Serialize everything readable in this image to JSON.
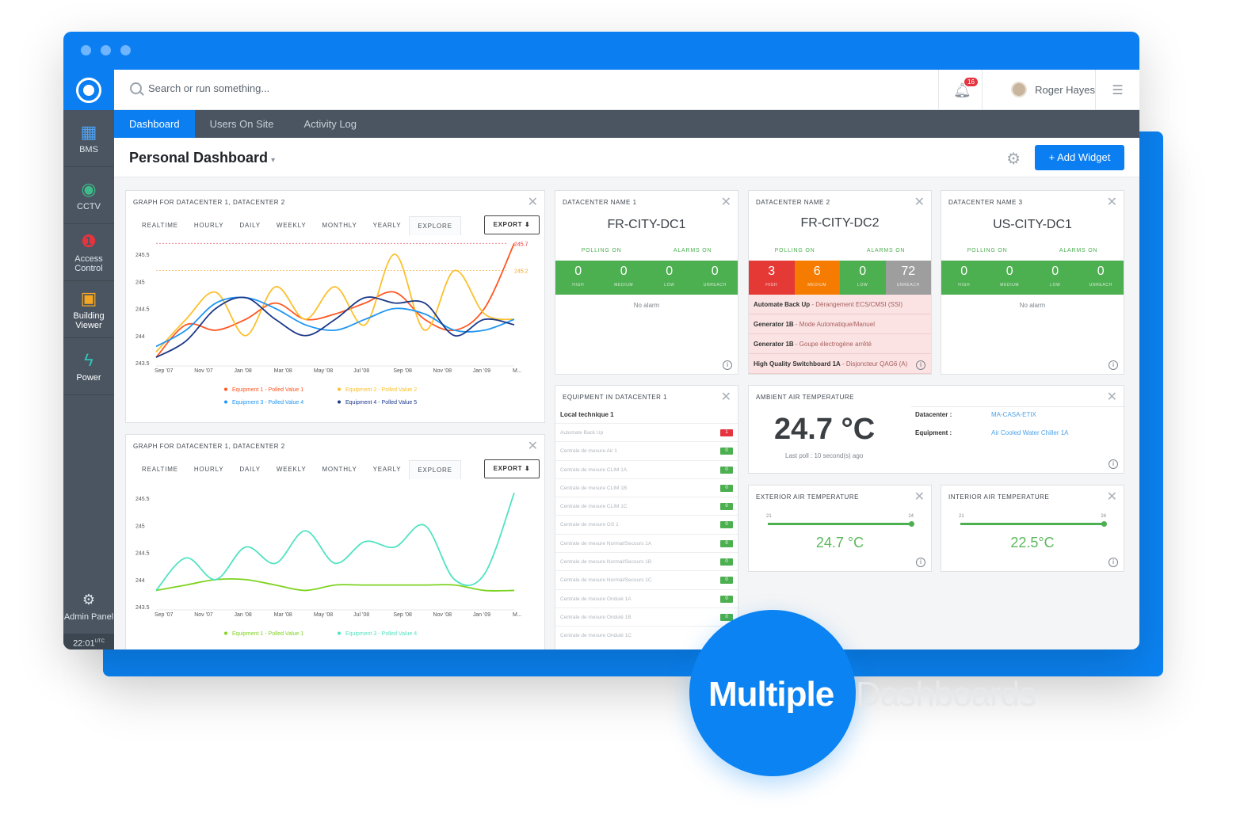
{
  "sidebar": {
    "items": [
      {
        "label": "BMS",
        "icon": "building-icon"
      },
      {
        "label": "CCTV",
        "icon": "camera-icon"
      },
      {
        "label": "Access Control",
        "icon": "lock-icon"
      },
      {
        "label": "Building Viewer",
        "icon": "floorplan-icon"
      },
      {
        "label": "Power",
        "icon": "bolt-icon"
      }
    ],
    "admin_label": "Admin Panel",
    "clock": "22:01",
    "clock_unit": "UTC"
  },
  "topbar": {
    "search_placeholder": "Search or run something...",
    "notification_count": "16",
    "user_name": "Roger Hayes"
  },
  "tabs": [
    "Dashboard",
    "Users On Site",
    "Activity Log"
  ],
  "dashboard": {
    "title": "Personal Dashboard",
    "add_widget_label": "+ Add Widget"
  },
  "time_tabs": [
    "REALTIME",
    "HOURLY",
    "DAILY",
    "WEEKLY",
    "MONTHLY",
    "YEARLY",
    "EXPLORE"
  ],
  "export_label": "EXPORT",
  "graph1": {
    "title": "GRAPH FOR DATACENTER 1, DATACENTER 2"
  },
  "graph2": {
    "title": "GRAPH FOR DATACENTER 1, DATACENTER 2"
  },
  "chart_data": [
    {
      "type": "line",
      "x": [
        "Sep '07",
        "Nov '07",
        "Jan '08",
        "Mar '08",
        "May '08",
        "Jul '08",
        "Sep '08",
        "Nov '08",
        "Jan '09",
        "M..."
      ],
      "ylim": [
        243.5,
        245.5
      ],
      "yticks": [
        "245.5",
        "245",
        "244.5",
        "244",
        "243.5"
      ],
      "thresholds": [
        {
          "value": 245.7,
          "label": "245.7",
          "color": "#e5343f"
        },
        {
          "value": 245.2,
          "label": "245.2",
          "color": "#f5a623"
        }
      ],
      "series": [
        {
          "name": "Equipment 1 - Polled Value 1",
          "color": "#ff5722",
          "values": [
            243.6,
            244.2,
            244.1,
            244.3,
            244.6,
            244.3,
            244.4,
            244.6,
            244.8,
            244.3,
            244.1,
            244.5,
            245.7
          ]
        },
        {
          "name": "Equipment 2 - Polled Value 2",
          "color": "#fbc02d",
          "values": [
            243.7,
            244.3,
            244.8,
            244.0,
            244.9,
            244.3,
            244.9,
            244.2,
            245.5,
            244.1,
            245.2,
            244.4,
            244.3
          ]
        },
        {
          "name": "Equipment 3 - Polled Value 4",
          "color": "#2196f3",
          "values": [
            243.8,
            244.1,
            244.6,
            244.7,
            244.5,
            244.2,
            244.1,
            244.3,
            244.5,
            244.4,
            244.1,
            244.1,
            244.3
          ]
        },
        {
          "name": "Equipment 4 - Polled Value 5",
          "color": "#1e3a8a",
          "values": [
            243.6,
            243.9,
            244.5,
            244.7,
            244.3,
            244.0,
            244.3,
            244.7,
            244.6,
            244.6,
            244.0,
            244.3,
            244.2
          ]
        }
      ]
    },
    {
      "type": "line",
      "x": [
        "Sep '07",
        "Nov '07",
        "Jan '08",
        "Mar '08",
        "May '08",
        "Jul '08",
        "Sep '08",
        "Nov '08",
        "Jan '09",
        "M..."
      ],
      "ylim": [
        243.5,
        245.5
      ],
      "yticks": [
        "245.5",
        "245",
        "244.5",
        "244",
        "243.5"
      ],
      "series": [
        {
          "name": "Equipment 1 - Polled Value 1",
          "color": "#7ed321",
          "values": [
            243.8,
            243.9,
            244.0,
            244.0,
            243.9,
            243.8,
            243.9,
            243.9,
            243.9,
            243.9,
            243.9,
            243.8,
            243.8
          ]
        },
        {
          "name": "Equipment 3 - Polled Value 4",
          "color": "#50e3c2",
          "values": [
            243.8,
            244.4,
            244.0,
            244.6,
            244.3,
            244.9,
            244.3,
            244.7,
            244.6,
            245.0,
            244.0,
            244.1,
            245.6
          ]
        }
      ]
    }
  ],
  "datacenters": [
    {
      "header": "DATACENTER NAME 1",
      "name": "FR-CITY-DC1",
      "polling": "POLLING ON",
      "alarms": "ALARMS ON",
      "cells": [
        {
          "n": "0",
          "l": "HIGH",
          "color": "#4caf50"
        },
        {
          "n": "0",
          "l": "MEDIUM",
          "color": "#4caf50"
        },
        {
          "n": "0",
          "l": "LOW",
          "color": "#4caf50"
        },
        {
          "n": "0",
          "l": "UNREACH",
          "color": "#4caf50"
        }
      ],
      "no_alarm": "No alarm"
    },
    {
      "header": "DATACENTER NAME 2",
      "name": "FR-CITY-DC2",
      "polling": "POLLING ON",
      "alarms": "ALARMS ON",
      "cells": [
        {
          "n": "3",
          "l": "HIGH",
          "color": "#e53935"
        },
        {
          "n": "6",
          "l": "MEDIUM",
          "color": "#f57c00"
        },
        {
          "n": "0",
          "l": "LOW",
          "color": "#4caf50"
        },
        {
          "n": "72",
          "l": "UNREACH",
          "color": "#9e9e9e"
        }
      ],
      "alarms_list": [
        {
          "b": "Automate Back Up",
          "t": " - Dérangement ECS/CMSI (SSI)"
        },
        {
          "b": "Generator 1B",
          "t": " - Mode Automatique/Manuel"
        },
        {
          "b": "Generator 1B",
          "t": " - Goupe électrogène arrêté"
        },
        {
          "b": "High Quality Switchboard 1A",
          "t": " - Disjoncteur QAG6 (A)"
        }
      ]
    },
    {
      "header": "DATACENTER NAME 3",
      "name": "US-CITY-DC1",
      "polling": "POLLING ON",
      "alarms": "ALARMS ON",
      "cells": [
        {
          "n": "0",
          "l": "HIGH",
          "color": "#4caf50"
        },
        {
          "n": "0",
          "l": "MEDIUM",
          "color": "#4caf50"
        },
        {
          "n": "0",
          "l": "LOW",
          "color": "#4caf50"
        },
        {
          "n": "0",
          "l": "UNREACH",
          "color": "#4caf50"
        }
      ],
      "no_alarm": "No alarm"
    }
  ],
  "equipment": {
    "title": "EQUIPMENT IN DATACENTER 1",
    "group": "Local technique 1",
    "rows": [
      {
        "name": "Automate Back Up",
        "v": "1",
        "color": "#e5343f"
      },
      {
        "name": "Centrale de mesure Air 1",
        "v": "0",
        "color": "#4caf50"
      },
      {
        "name": "Centrale de mesure CLIM 1A",
        "v": "0",
        "color": "#4caf50"
      },
      {
        "name": "Centrale de mesure CLIM 1B",
        "v": "0",
        "color": "#4caf50"
      },
      {
        "name": "Centrale de mesure CLIM 1C",
        "v": "0",
        "color": "#4caf50"
      },
      {
        "name": "Centrale de mesure GS 1",
        "v": "0",
        "color": "#4caf50"
      },
      {
        "name": "Centrale de mesure Normal/Secours 1A",
        "v": "0",
        "color": "#4caf50"
      },
      {
        "name": "Centrale de mesure Normal/Secours 1B",
        "v": "0",
        "color": "#4caf50"
      },
      {
        "name": "Centrale de mesure Normal/Secours 1C",
        "v": "0",
        "color": "#4caf50"
      },
      {
        "name": "Centrale de mesure Onduié 1A",
        "v": "0",
        "color": "#4caf50"
      },
      {
        "name": "Centrale de mesure Ondulé 1B",
        "v": "0",
        "color": "#4caf50"
      },
      {
        "name": "Centrale de mesure Ondulé 1C",
        "v": ""
      }
    ]
  },
  "ambient": {
    "title": "AMBIENT AIR TEMPERATURE",
    "value": "24.7 °C",
    "last_poll": "Last poll : 10 second(s) ago",
    "datacenter_label": "Datacenter :",
    "datacenter_value": "MA-CASA-ETIX",
    "equipment_label": "Equipment :",
    "equipment_value": "Air Cooled Water Chiller 1A"
  },
  "exterior": {
    "title": "EXTERIOR AIR TEMPERATURE",
    "min": "21",
    "max": "24",
    "value": "24.7 °C"
  },
  "interior": {
    "title": "INTERIOR AIR TEMPERATURE",
    "min": "21",
    "max": "24",
    "value": "22.5°C"
  },
  "tagline": {
    "bold": "Multiple",
    "light": "Dashboards"
  }
}
